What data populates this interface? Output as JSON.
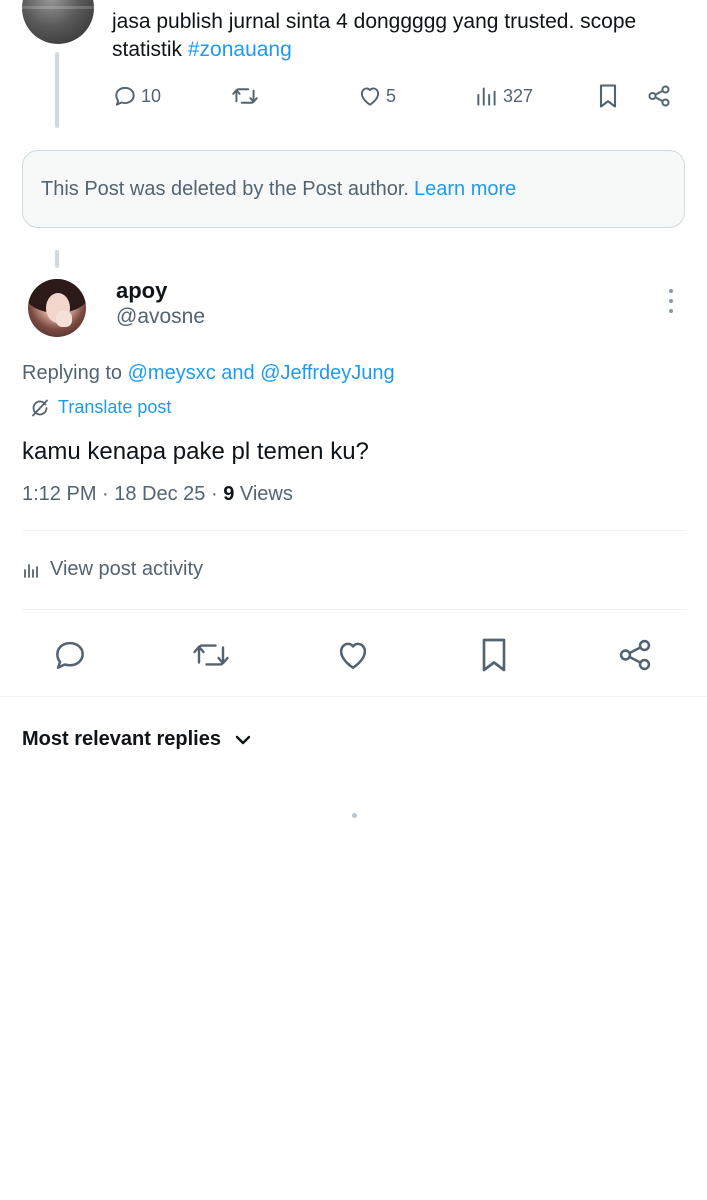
{
  "parent_post": {
    "text": "jasa publish jurnal sinta 4 donggggg yang trusted. scope statistik ",
    "hashtag": "#zonauang",
    "actions": {
      "replies": "10",
      "reposts": "",
      "likes": "5",
      "views": "327"
    },
    "icons": [
      "reply-icon",
      "repost-icon",
      "like-icon",
      "views-icon",
      "bookmark-icon",
      "share-icon"
    ]
  },
  "deleted_notice": {
    "text": "This Post was deleted by the Post author.",
    "link": "Learn more"
  },
  "reply": {
    "display_name": "apoy",
    "handle": "@avosne",
    "replying_prefix": "Replying to ",
    "mention_1": "@meysxc",
    "mention_join": " and ",
    "mention_2": "@JeffrdeyJung",
    "translate_label": "Translate post",
    "text": "kamu kenapa pake pl temen ku?",
    "time_date": "1:12 PM · 18 Dec 25 · ",
    "views_count": "9",
    "views_label": " Views",
    "activity_label": "View post activity"
  },
  "replies_section": {
    "sort_label": "Most relevant replies"
  },
  "colors": {
    "accent": "#1d9bf0",
    "text_primary": "#0f1419",
    "text_secondary": "#536471",
    "border": "#cfd9de"
  }
}
